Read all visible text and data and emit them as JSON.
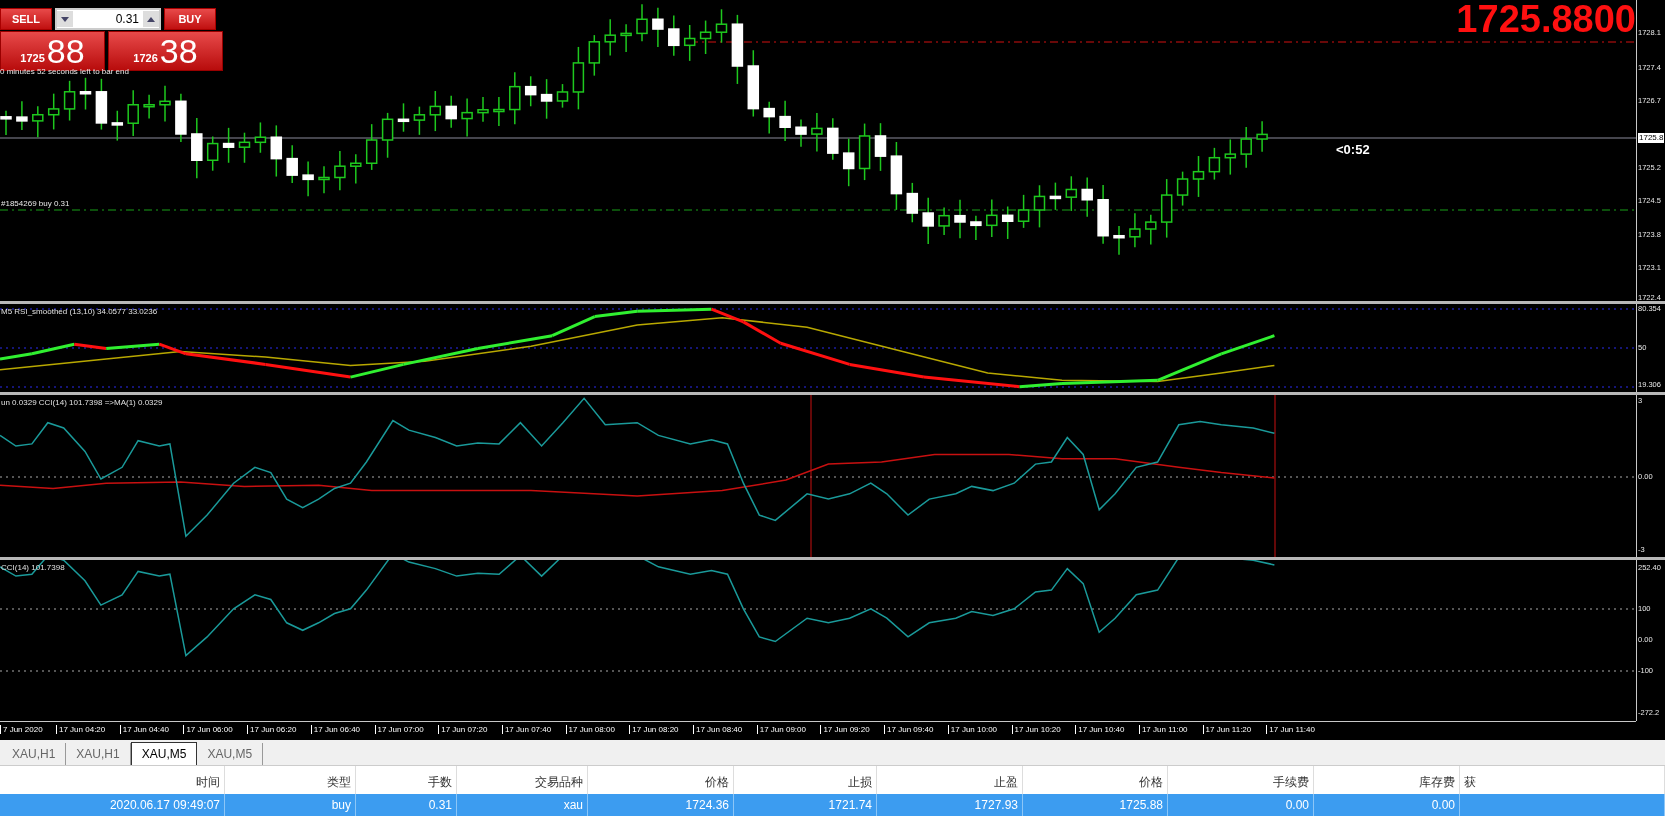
{
  "trade_panel": {
    "sell_label": "SELL",
    "buy_label": "BUY",
    "volume": "0.31",
    "bid": {
      "handle": "1725",
      "pips": "88"
    },
    "ask": {
      "handle": "1726",
      "pips": "38"
    }
  },
  "main_chart": {
    "big_price": "1725.8800",
    "bar_timer": "0 minutes 52 seconds left to bar end",
    "order_label": "#1854269 buy 0.31",
    "countdown": "<0:52",
    "current_price_tag": "1725.8",
    "axis_labels": [
      "1728.1",
      "1727.4",
      "1726.7",
      "1725.2",
      "1724.5",
      "1723.8",
      "1723.1",
      "1722.4"
    ]
  },
  "rsi_pane": {
    "title": "M5  RSI_smoothed (13,10) 34.0577 33.0236",
    "axis_labels": [
      "80.354",
      "50",
      "19.306"
    ]
  },
  "cci_ma_pane": {
    "title": "un 0.0329  CCI(14) 101.7398  =>MA(1) 0.0329",
    "axis_labels": [
      "3",
      "0.00",
      "-3"
    ]
  },
  "cci_pane": {
    "title": "CCI(14) 101.7398",
    "axis_labels": [
      "252.40",
      "100",
      "0.00",
      "-100",
      "-272.2"
    ]
  },
  "time_axis": [
    "7 Jun 2020",
    "17 Jun 04:20",
    "17 Jun 04:40",
    "17 Jun 06:00",
    "17 Jun 06:20",
    "17 Jun 06:40",
    "17 Jun 07:00",
    "17 Jun 07:20",
    "17 Jun 07:40",
    "17 Jun 08:00",
    "17 Jun 08:20",
    "17 Jun 08:40",
    "17 Jun 09:00",
    "17 Jun 09:20",
    "17 Jun 09:40",
    "17 Jun 10:00",
    "17 Jun 10:20",
    "17 Jun 10:40",
    "17 Jun 11:00",
    "17 Jun 11:20",
    "17 Jun 11:40"
  ],
  "tabs": [
    {
      "label": "XAU,H1",
      "selected": false
    },
    {
      "label": "XAU,H1",
      "selected": false
    },
    {
      "label": "XAU,M5",
      "selected": true
    },
    {
      "label": "XAU,M5",
      "selected": false
    }
  ],
  "table": {
    "columns": [
      "时间",
      "类型",
      "手数",
      "交易品种",
      "价格",
      "止损",
      "止盈",
      "价格",
      "手续费",
      "库存费",
      "获"
    ],
    "rows": [
      {
        "selected": true,
        "cells": [
          "2020.06.17 09:49:07",
          "buy",
          "0.31",
          "xau",
          "1724.36",
          "1721.74",
          "1727.93",
          "1725.88",
          "0.00",
          "0.00"
        ]
      }
    ]
  }
}
